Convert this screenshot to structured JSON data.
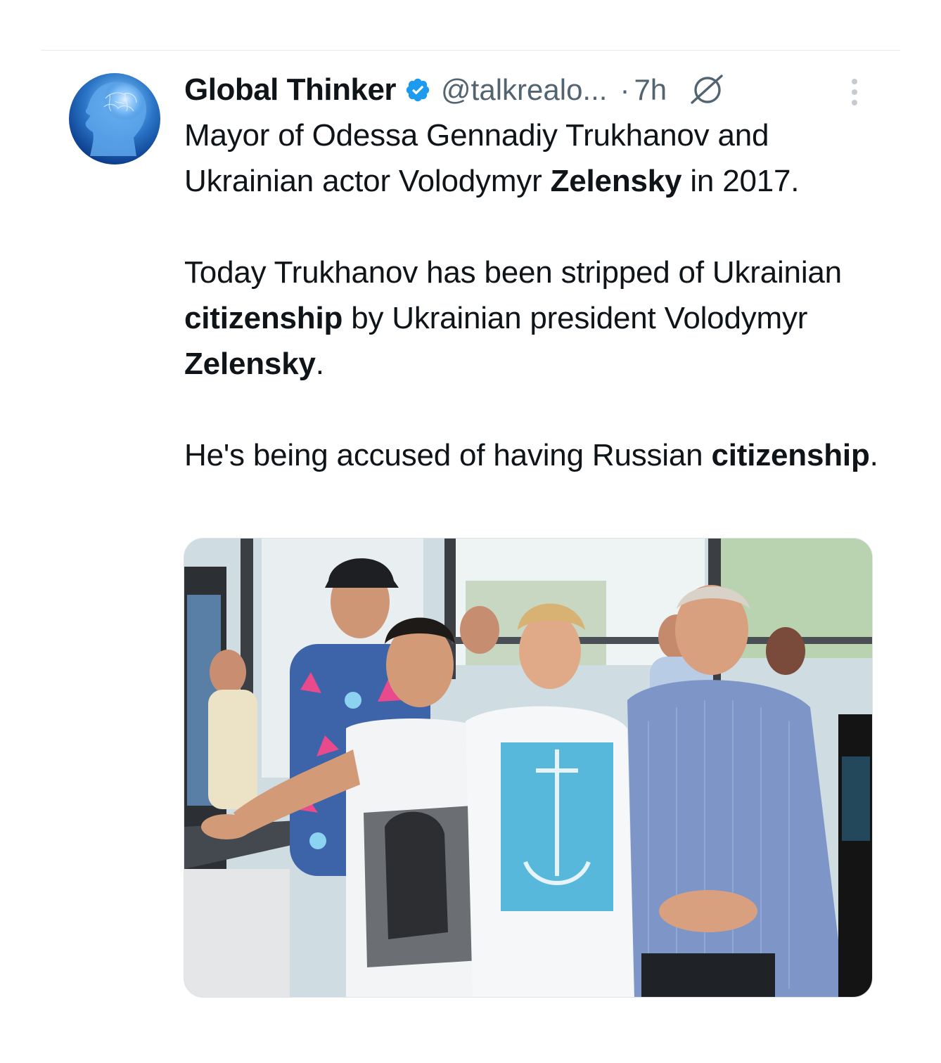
{
  "tweet": {
    "author": {
      "name": "Global Thinker",
      "handle": "@talkrealo...",
      "verified": true,
      "avatar": "brain-head-avatar"
    },
    "separator": "·",
    "time": "7h",
    "paragraphs": [
      {
        "segments": [
          {
            "text": "Mayor of Odessa Gennadiy Trukhanov and Ukrainian actor Volodymyr ",
            "bold": false
          },
          {
            "text": "Zelensky",
            "bold": true
          },
          {
            "text": " in 2017.",
            "bold": false
          }
        ]
      },
      {
        "segments": [
          {
            "text": "Today Trukhanov has been stripped of Ukrainian ",
            "bold": false
          },
          {
            "text": "citizenship",
            "bold": true
          },
          {
            "text": " by Ukrainian president Volodymyr ",
            "bold": false
          },
          {
            "text": "Zelensky",
            "bold": true
          },
          {
            "text": ".",
            "bold": false
          }
        ]
      },
      {
        "segments": [
          {
            "text": "He's being accused of having Russian ",
            "bold": false
          },
          {
            "text": "citizenship",
            "bold": true
          },
          {
            "text": ".",
            "bold": false
          }
        ]
      }
    ],
    "media": {
      "type": "photo",
      "subject": "group-photo"
    }
  },
  "icons": {
    "verified": "verified-badge-icon",
    "grok": "grok-icon",
    "more": "more-options-icon"
  },
  "colors": {
    "text_primary": "#0f1419",
    "text_secondary": "#536471",
    "verified_blue": "#1d9bf0",
    "divider": "#e6e9ec"
  }
}
